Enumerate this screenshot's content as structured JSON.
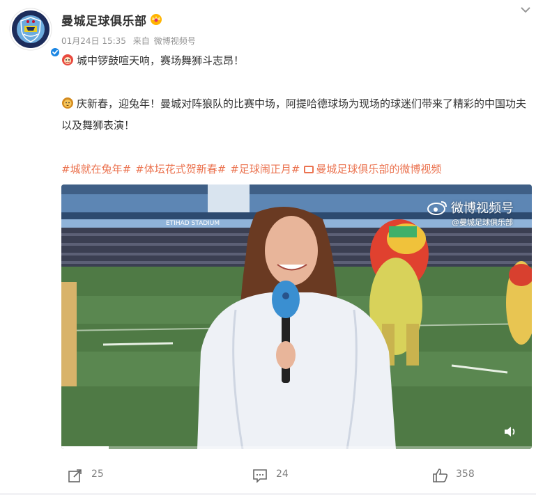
{
  "post": {
    "author": "曼城足球俱乐部",
    "date": "01月24日 15:35",
    "source_prefix": "来自",
    "source": "微博视频号",
    "line1": "城中锣鼓喧天响，赛场舞狮斗志昂！",
    "line2": "庆新春，迎兔年！曼城对阵狼队的比赛中场，阿提哈德球场为现场的球迷们带来了精彩的中国功夫以及舞狮表演！",
    "tags": [
      "#城就在兔年#",
      "#体坛花式贺新春#",
      "#足球闹正月#"
    ],
    "video_link": "曼城足球俱乐部的微博视频"
  },
  "video": {
    "watermark_title": "微博视频号",
    "watermark_sub": "@曼城足球俱乐部",
    "progress": 0.1,
    "stadium_sign": "ETIHAD STADIUM"
  },
  "actions": {
    "share_count": "25",
    "comment_count": "24",
    "like_count": "358"
  },
  "colors": {
    "tag": "#eb7350",
    "verify": "#1b86e3"
  },
  "icons": {
    "more": "chevron-down-icon",
    "share": "share-icon",
    "comment": "comment-icon",
    "like": "thumbs-up-icon",
    "volume": "volume-icon"
  }
}
